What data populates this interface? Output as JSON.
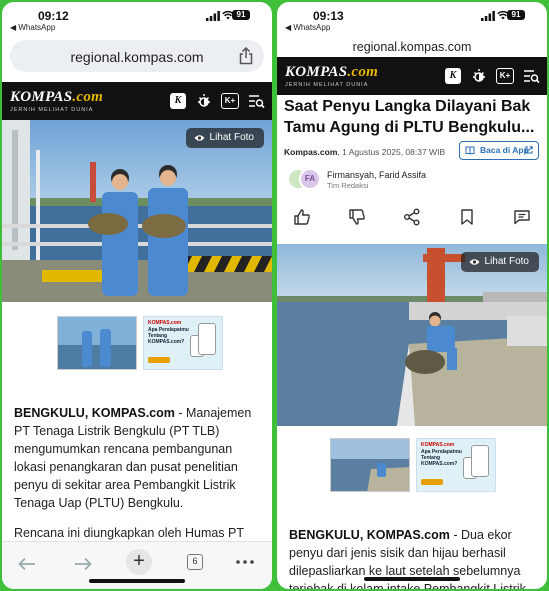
{
  "left": {
    "status": {
      "time": "09:12",
      "back_app": "◀ WhatsApp",
      "battery": "91"
    },
    "url": "regional.kompas.com",
    "kompas": {
      "logo": "KOMPAS",
      "logo_suffix": ".com",
      "tagline": "JERNIH MELIHAT DUNIA",
      "kplus": "K+"
    },
    "photo_button": "Lihat Foto",
    "ad": {
      "brand": "KOMPAS.com",
      "text": "Apa Pendapatmu Tentang KOMPAS.com?"
    },
    "article": {
      "dateline": "BENGKULU, KOMPAS.com",
      "para1": " - Manajemen PT Tenaga Listrik Bengkulu (PT TLB) mengumumkan rencana pembangunan lokasi penangkaran dan pusat penelitian penyu di sekitar area Pembangkit Listrik Tenaga Uap (PLTU) Bengkulu.",
      "para2": "Rencana ini diungkapkan oleh Humas PT"
    },
    "toolbar": {
      "tabs": "6"
    }
  },
  "right": {
    "status": {
      "time": "09:13",
      "back_app": "◀ WhatsApp",
      "battery": "91"
    },
    "url": "regional.kompas.com",
    "kompas": {
      "logo": "KOMPAS",
      "logo_suffix": ".com",
      "tagline": "JERNIH MELIHAT DUNIA",
      "kplus": "K+"
    },
    "headline": "Saat Penyu Langka Dilayani Bak Tamu Agung di PLTU Bengkulu...",
    "meta": {
      "source": "Kompas.com",
      "date": ", 1 Agustus 2025, 08:37 WIB"
    },
    "baca_button": "Baca di App",
    "avatar_initials": "FA",
    "authors": "Firmansyah,  Farid Assifa",
    "team": "Tim Redaksi",
    "photo_button": "Lihat Foto",
    "ad": {
      "brand": "KOMPAS.com",
      "text": "Apa Pendapatmu Tentang KOMPAS.com?"
    },
    "article": {
      "dateline": "BENGKULU, KOMPAS.com",
      "para1": " - Dua ekor penyu dari jenis sisik dan hijau berhasil dilepasliarkan ke laut setelah sebelumnya terjebak di kolam intake Pembangkit Listrik"
    }
  },
  "colors": {
    "frame": "#3fbf3a",
    "kompas_bar": "#111111",
    "accent_blue": "#2c6fb5",
    "sky": "#8fb8da",
    "sea": "#5b7fa0"
  }
}
